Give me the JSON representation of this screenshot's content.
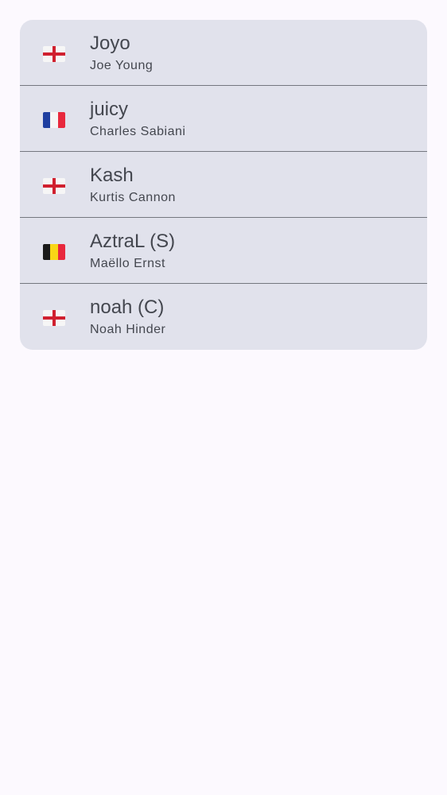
{
  "players": [
    {
      "tag": "Joyo",
      "name": "Joe Young",
      "flag": "england"
    },
    {
      "tag": "juicy",
      "name": "Charles Sabiani",
      "flag": "france"
    },
    {
      "tag": "Kash",
      "name": "Kurtis Cannon",
      "flag": "england"
    },
    {
      "tag": "AztraL (S)",
      "name": "Maëllo Ernst",
      "flag": "belgium"
    },
    {
      "tag": "noah (C)",
      "name": "Noah Hinder",
      "flag": "england"
    }
  ],
  "colors": {
    "france": [
      "#1f3fa0",
      "#f5f5f5",
      "#e8283d"
    ],
    "belgium": [
      "#1a1a1a",
      "#f9d616",
      "#e8283d"
    ]
  }
}
